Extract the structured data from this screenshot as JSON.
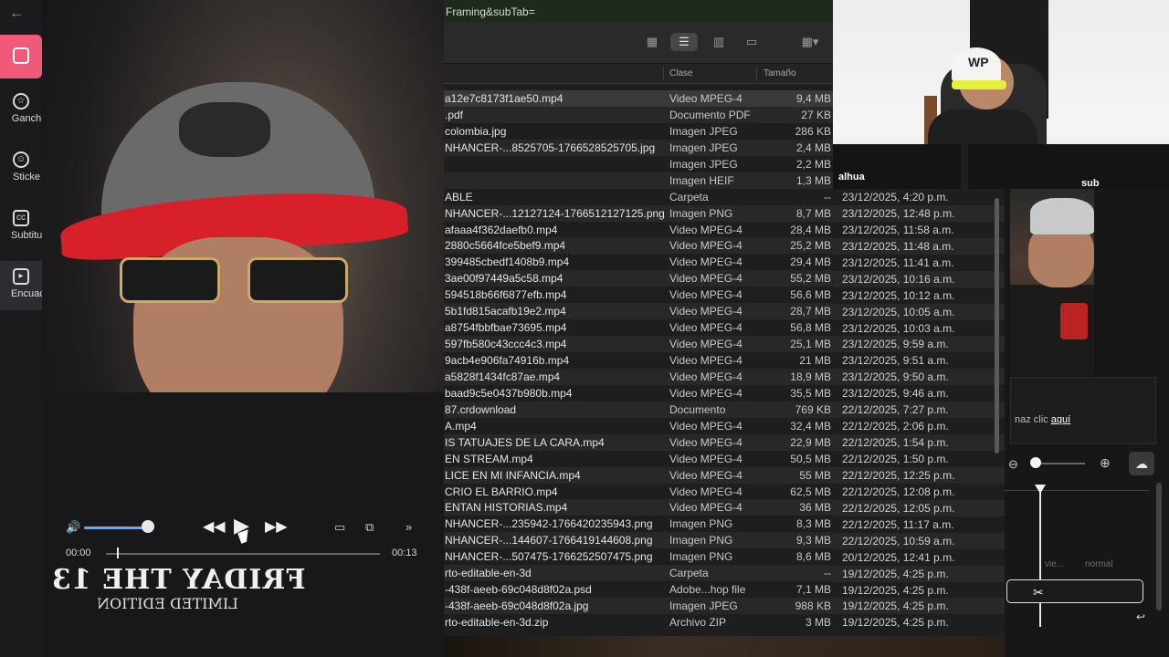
{
  "editor": {
    "back_icon": "arrow-left-icon",
    "sidebar": [
      {
        "label": "Ganch",
        "icon": "star-icon"
      },
      {
        "label": "Sticke",
        "icon": "sticker-icon"
      },
      {
        "label": "Subtitu",
        "icon": "cc-icon"
      },
      {
        "label": "Encuac",
        "icon": "framing-icon"
      }
    ]
  },
  "player": {
    "elapsed": "00:00",
    "total": "00:13",
    "volume": 0.9,
    "progress": 0.0
  },
  "video_left": {
    "shirt_text_1": "FRIDAY THE 13",
    "shirt_text_2": "LIMITED EDITION"
  },
  "finder": {
    "url_fragment": "Framing&subTab=",
    "columns": {
      "kind": "Clase",
      "size": "Tamaño"
    },
    "rows": [
      {
        "name": "a12e7c8173f1ae50.mp4",
        "kind": "Video MPEG-4",
        "size": "9,4 MB"
      },
      {
        "name": ".pdf",
        "kind": "Documento PDF",
        "size": "27 KB"
      },
      {
        "name": "colombia.jpg",
        "kind": "Imagen JPEG",
        "size": "286 KB"
      },
      {
        "name": "NHANCER-...8525705-1766528525705.jpg",
        "kind": "Imagen JPEG",
        "size": "2,4 MB"
      },
      {
        "name": "",
        "kind": "Imagen JPEG",
        "size": "2,2 MB"
      },
      {
        "name": "",
        "kind": "Imagen HEIF",
        "size": "1,3 MB"
      },
      {
        "name": "ABLE",
        "kind": "Carpeta",
        "size": "--"
      },
      {
        "name": "NHANCER-...12127124-1766512127125.png",
        "kind": "Imagen PNG",
        "size": "8,7 MB"
      },
      {
        "name": "afaaa4f362daefb0.mp4",
        "kind": "Video MPEG-4",
        "size": "28,4 MB"
      },
      {
        "name": "2880c5664fce5bef9.mp4",
        "kind": "Video MPEG-4",
        "size": "25,2 MB"
      },
      {
        "name": "399485cbedf1408b9.mp4",
        "kind": "Video MPEG-4",
        "size": "29,4 MB"
      },
      {
        "name": "3ae00f97449a5c58.mp4",
        "kind": "Video MPEG-4",
        "size": "55,2 MB"
      },
      {
        "name": "594518b66f6877efb.mp4",
        "kind": "Video MPEG-4",
        "size": "56,6 MB"
      },
      {
        "name": "5b1fd815acafb19e2.mp4",
        "kind": "Video MPEG-4",
        "size": "28,7 MB"
      },
      {
        "name": "a8754fbbfbae73695.mp4",
        "kind": "Video MPEG-4",
        "size": "56,8 MB"
      },
      {
        "name": "597fb580c43ccc4c3.mp4",
        "kind": "Video MPEG-4",
        "size": "25,1 MB"
      },
      {
        "name": "9acb4e906fa74916b.mp4",
        "kind": "Video MPEG-4",
        "size": "21 MB"
      },
      {
        "name": "a5828f1434fc87ae.mp4",
        "kind": "Video MPEG-4",
        "size": "18,9 MB"
      },
      {
        "name": "baad9c5e0437b980b.mp4",
        "kind": "Video MPEG-4",
        "size": "35,5 MB"
      },
      {
        "name": "87.crdownload",
        "kind": "Documento",
        "size": "769 KB"
      },
      {
        "name": "A.mp4",
        "kind": "Video MPEG-4",
        "size": "32,4 MB"
      },
      {
        "name": "IS TATUAJES DE LA CARA.mp4",
        "kind": "Video MPEG-4",
        "size": "22,9 MB"
      },
      {
        "name": "EN STREAM.mp4",
        "kind": "Video MPEG-4",
        "size": "50,5 MB"
      },
      {
        "name": "LICE EN MI INFANCIA.mp4",
        "kind": "Video MPEG-4",
        "size": "55 MB"
      },
      {
        "name": "CRIO EL BARRIO.mp4",
        "kind": "Video MPEG-4",
        "size": "62,5 MB"
      },
      {
        "name": "ENTAN HISTORIAS.mp4",
        "kind": "Video MPEG-4",
        "size": "36 MB"
      },
      {
        "name": "NHANCER-...235942-1766420235943.png",
        "kind": "Imagen PNG",
        "size": "8,3 MB"
      },
      {
        "name": "NHANCER-...144607-1766419144608.png",
        "kind": "Imagen PNG",
        "size": "9,3 MB"
      },
      {
        "name": "NHANCER-...507475-1766252507475.png",
        "kind": "Imagen PNG",
        "size": "8,6 MB"
      },
      {
        "name": "rto-editable-en-3d",
        "kind": "Carpeta",
        "size": "--"
      },
      {
        "name": "-438f-aeeb-69c048d8f02a.psd",
        "kind": "Adobe...hop file",
        "size": "7,1 MB"
      },
      {
        "name": "-438f-aeeb-69c048d8f02a.jpg",
        "kind": "Imagen JPEG",
        "size": "988 KB"
      },
      {
        "name": "rto-editable-en-3d.zip",
        "kind": "Archivo ZIP",
        "size": "3 MB"
      }
    ],
    "dates": [
      "23/12/2025, 4:20 p.m.",
      "23/12/2025, 12:48 p.m.",
      "23/12/2025, 11:58 a.m.",
      "23/12/2025, 11:48 a.m.",
      "23/12/2025, 11:41 a.m.",
      "23/12/2025, 10:16 a.m.",
      "23/12/2025, 10:12 a.m.",
      "23/12/2025, 10:05 a.m.",
      "23/12/2025, 10:03 a.m.",
      "23/12/2025, 9:59 a.m.",
      "23/12/2025, 9:51 a.m.",
      "23/12/2025, 9:50 a.m.",
      "23/12/2025, 9:46 a.m.",
      "22/12/2025, 7:27 p.m.",
      "22/12/2025, 2:06 p.m.",
      "22/12/2025, 1:54 p.m.",
      "22/12/2025, 1:50 p.m.",
      "22/12/2025, 12:25 p.m.",
      "22/12/2025, 12:08 p.m.",
      "22/12/2025, 12:05 p.m.",
      "22/12/2025, 11:17 a.m.",
      "22/12/2025, 10:59 a.m.",
      "20/12/2025, 12:41 p.m.",
      "19/12/2025, 4:25 p.m.",
      "19/12/2025, 4:25 p.m.",
      "19/12/2025, 4:25 p.m.",
      "19/12/2025, 4:25 p.m."
    ]
  },
  "webcam": {
    "hat_text": "WP",
    "watermark_left": "alhua",
    "watermark_right": "sub"
  },
  "right_panel": {
    "dialog_text": "naz clic ",
    "dialog_link": "aquí",
    "track_labels": [
      "vie...",
      "normal"
    ],
    "colors": {
      "accent": "#f05a79"
    }
  }
}
